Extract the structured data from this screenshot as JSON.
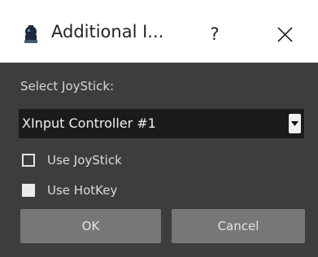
{
  "window": {
    "title": "Additional I...",
    "help_label": "?",
    "app_icon": "joystick-icon",
    "close_icon": "close-icon"
  },
  "form": {
    "select_label": "Select JoyStick:",
    "joystick_selected": "XInput Controller #1",
    "use_joystick": {
      "label": "Use JoyStick",
      "checked": false
    },
    "use_hotkey": {
      "label": "Use HotKey",
      "checked": true
    }
  },
  "buttons": {
    "ok_label": "OK",
    "cancel_label": "Cancel"
  },
  "colors": {
    "client_background": "#3d3d3d",
    "dropdown_background": "#1b1b1b",
    "button_background": "#777777",
    "text_light": "#dcdcdc"
  }
}
